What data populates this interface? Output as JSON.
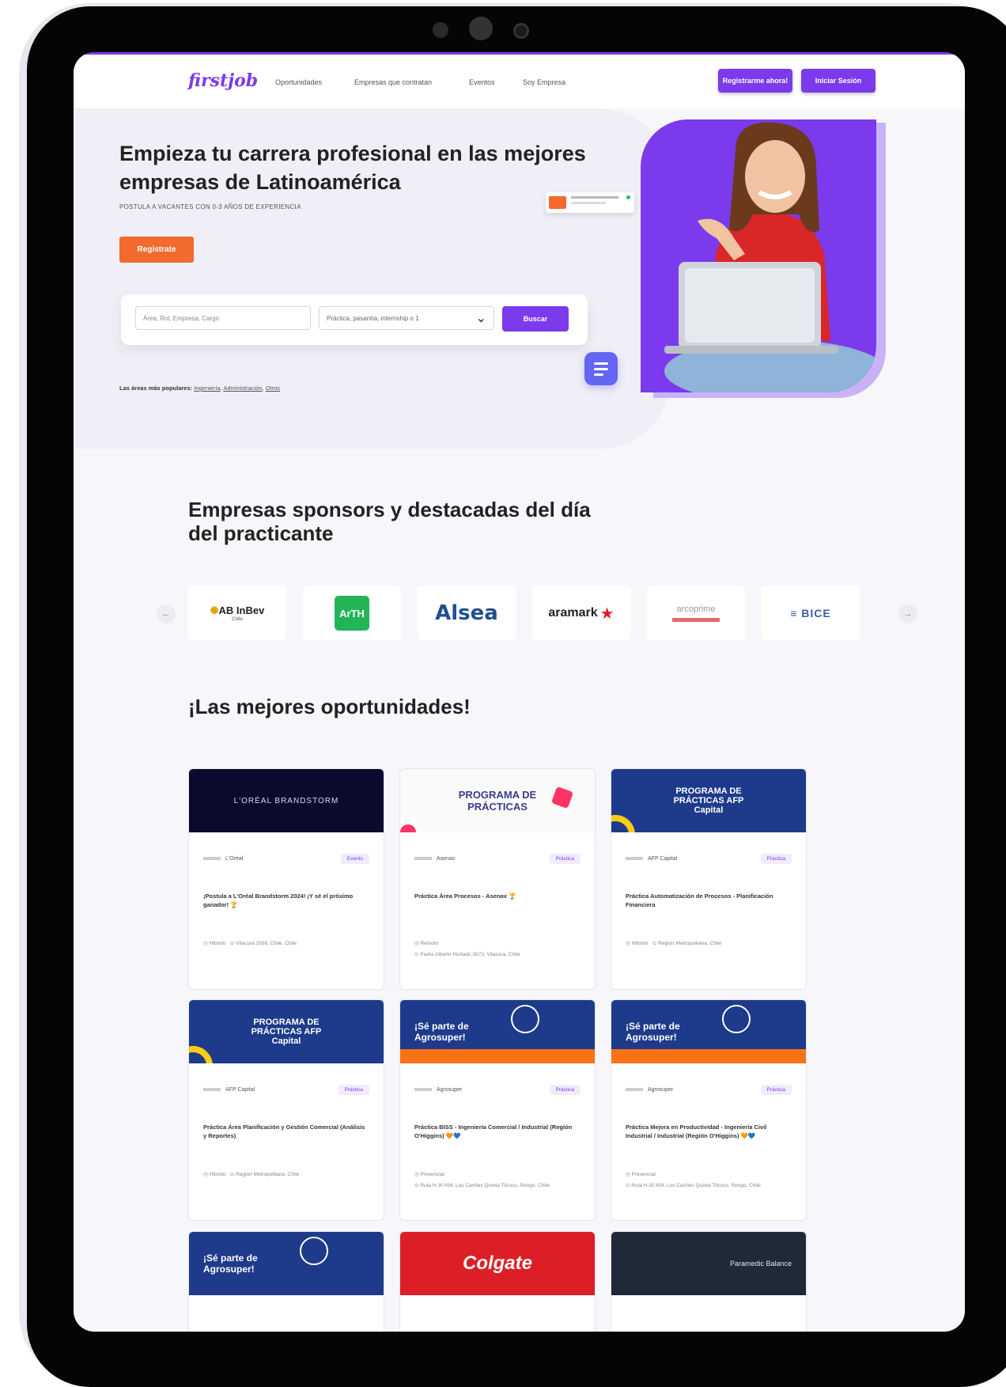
{
  "nav": {
    "logo": "firstjob",
    "links": [
      "Oportunidades",
      "Empresas que contratan",
      "Eventos",
      "Soy Empresa"
    ],
    "register_button": "Registrarme ahora!",
    "login_button": "Iniciar Sesión"
  },
  "hero": {
    "title": "Empieza tu carrera profesional en las mejores empresas de Latinoamérica",
    "subtitle": "POSTULA A VACANTES CON 0-3 AÑOS DE EXPERIENCIA",
    "register_button": "Registrate",
    "search": {
      "keyword_placeholder": "Área, Rol, Empresa, Cargo",
      "type_value": "Práctica, pasantía, internship o 1",
      "search_button": "Buscar"
    },
    "popular_label": "Las áreas más populares:",
    "popular_links": [
      "Ingeniería",
      "Administración",
      "Otros"
    ]
  },
  "sponsors": {
    "title": "Empresas sponsors y destacadas del día del practicante",
    "prev": "←",
    "next": "→",
    "logos": [
      "AB InBev",
      "ArTH",
      "Alsea",
      "aramark",
      "arcoprime",
      "BICE"
    ],
    "logo_subtitles": {
      "abinbev": "Chile"
    }
  },
  "opportunities": {
    "title": "¡Las mejores oportunidades!",
    "cards": [
      {
        "banner": "L'ORÉAL BRANDSTORM",
        "company": "L'Oréal",
        "type": "Evento",
        "title": "¡Postula a L'Oréal Brandstorm 2024! ¡Y sé el próximo ganador! 🏆",
        "modality": "Híbrido",
        "location": "Vitacura 2939, Chile, Chile"
      },
      {
        "banner": "PROGRAMA DE PRÁCTICAS",
        "company": "Asenav",
        "type": "Práctica",
        "title": "Práctica Área Procesos - Asenav 🏆",
        "modality": "Remoto",
        "location": "Padre Alberto Hurtado 0873, Vitacura, Chile"
      },
      {
        "banner": "PROGRAMA DE PRÁCTICAS AFP Capital",
        "company": "AFP Capital",
        "type": "Práctica",
        "title": "Práctica Automatización de Procesos - Planificación Financiera",
        "modality": "Híbrido",
        "location": "Región Metropolitana, Chile"
      },
      {
        "banner": "PROGRAMA DE PRÁCTICAS AFP Capital",
        "company": "AFP Capital",
        "type": "Práctica",
        "title": "Práctica Área Planificación y Gestión Comercial (Análisis y Reportes)",
        "modality": "Híbrido",
        "location": "Región Metropolitana, Chile"
      },
      {
        "banner": "¡Sé parte de Agrosuper!",
        "company": "Agrosuper",
        "type": "Práctica",
        "title": "Práctica BISS - Ingeniería Comercial / Industrial (Región O'Higgins) 🧡💙",
        "modality": "Presencial",
        "location": "Ruta H-30 KM. Los Carriles Quinta Tilcoco, Rengo, Chile"
      },
      {
        "banner": "¡Sé parte de Agrosuper!",
        "company": "Agrosuper",
        "type": "Práctica",
        "title": "Práctica Mejora en Productividad - Ingeniería Civil Industrial / Industrial (Región O'Higgins) 🧡💙",
        "modality": "Presencial",
        "location": "Ruta H-30 KM. Los Carriles Quinta Tilcoco, Rengo, Chile"
      }
    ],
    "more_banners": [
      "¡Sé parte de Agrosuper!",
      "Colgate",
      "Paramedic Balance"
    ]
  },
  "colors": {
    "brand": "#7c3aed",
    "accent": "#f26a2e",
    "navy": "#1e3a8a"
  }
}
